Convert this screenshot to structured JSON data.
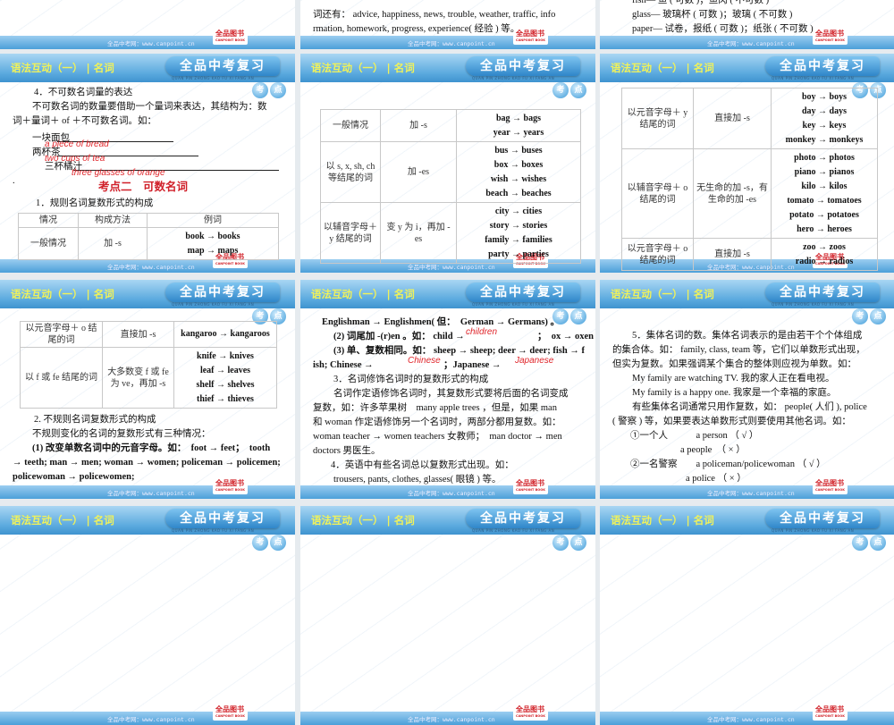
{
  "header": {
    "title_left": "语法互动（一）",
    "sep": "|",
    "title_right": "名词",
    "brand": "全品中考复习",
    "brand_sub": "QUAN PIN ZHONG KAO FU XI FANG AN",
    "badge_1": "考",
    "badge_2": "点"
  },
  "footer": {
    "site": "全品中考网：www.canpoint.cn",
    "logo": "全品图书",
    "logo_sub": "CANPOINT BOOK"
  },
  "slides": {
    "top_middle": {
      "lines": [
        "词还有： advice, happiness, news, trouble, weather, traffic, info",
        "rmation, homework, progress, experience( 经验 ) 等。"
      ]
    },
    "top_right": {
      "lines": [
        "fish— 鱼 ( 可数 )；鱼肉 ( 不可数 )",
        "glass— 玻璃杯 ( 可数 )；玻璃 ( 不可数 )",
        "paper— 试卷，报纸 ( 可数 )；纸张 ( 不可数 )"
      ]
    },
    "s1": {
      "heading": "4．不可数名词量的表达",
      "p1": "不可数名词的数量要借助一个量词来表达，其结构为：数",
      "p2": "词＋量词＋ of ＋不可数名词。如：",
      "q1": "一块面包",
      "a1": "a piece of bread",
      "q2": "两杯茶",
      "a2": "two cups of tea",
      "q3": "三杯橘汁",
      "a3": "three glasses of orange",
      "dot": ".",
      "section": "考点二　可数名词",
      "sub": "1．规则名词复数形式的构成",
      "table": {
        "headers": [
          "情况",
          "构成方法",
          "例词"
        ],
        "rows": [
          {
            "case": "一般情况",
            "method": "加 -s",
            "examples": [
              "book → books",
              "map → maps"
            ]
          }
        ]
      }
    },
    "s2": {
      "table": {
        "rows": [
          {
            "case": "一般情况",
            "method": "加 -s",
            "examples": [
              "bag → bags",
              "year → years"
            ]
          },
          {
            "case": "以 s, x, sh, ch 等结尾的词",
            "method": "加 -es",
            "examples": [
              "bus → buses",
              "box → boxes",
              "wish → wishes",
              "beach → beaches"
            ]
          },
          {
            "case": "以辅音字母＋ y 结尾的词",
            "method": "变 y 为 i，再加 -es",
            "examples": [
              "city → cities",
              "story → stories",
              "family → families",
              "party → parties"
            ]
          }
        ]
      }
    },
    "s3": {
      "table": {
        "rows": [
          {
            "case": "以元音字母＋ y 结尾的词",
            "method": "直接加 -s",
            "examples": [
              "boy → boys",
              "day → days",
              "key → keys",
              "monkey → monkeys"
            ]
          },
          {
            "case": "以辅音字母＋ o 结尾的词",
            "method": "无生命的加 -s，有生命的加 -es",
            "examples": [
              "photo → photos",
              "piano → pianos",
              "kilo → kilos",
              "tomato → tomatoes",
              "potato → potatoes",
              "hero → heroes"
            ]
          },
          {
            "case": "以元音字母＋ o 结尾的词",
            "method": "直接加 -s",
            "examples": [
              "zoo → zoos",
              "radio → radios"
            ]
          }
        ]
      }
    },
    "s4": {
      "table": {
        "rows": [
          {
            "case": "以元音字母＋ o 结尾的词",
            "method": "直接加 -s",
            "examples": [
              "kangaroo → kangaroos"
            ]
          },
          {
            "case": "以 f 或 fe 结尾的词",
            "method": "大多数变 f 或 fe 为 ve，再加 -s",
            "examples": [
              "knife → knives",
              "leaf → leaves",
              "shelf → shelves",
              "thief → thieves"
            ]
          }
        ]
      },
      "lines": [
        "2. 不规则名词复数形式的构成",
        "不规则变化的名词的复数形式有三种情况：",
        "(1) 改变单数名词中的元音字母。如：　foot → feet；　tooth",
        "→ teeth;  man → men;  woman → women;  policeman → policemen;",
        "policewoman → policewomen;"
      ]
    },
    "s5": {
      "l1": "Englishman → Englishmen( 但：　German → Germans) 。",
      "l2a": "(2) 词尾加 -(r)en 。如：  child →",
      "a_children": "children",
      "l2b": "；　ox → oxen",
      "l3": "(3) 单、复数相同。如：  sheep → sheep; deer → deer; fish → f",
      "l4a": "ish; Chinese →",
      "a_chinese": "Chinese",
      "l4b": "；Japanese →",
      "a_japanese": "Japanese",
      "lines": [
        "3．名词修饰名词时的复数形式的构成",
        "名词作定语修饰名词时，其复数形式要将后面的名词变成",
        "复数，如：许多苹果树　many apple trees ，但是，如果 man",
        "和 woman 作定语修饰另一个名词时，两部分都用复数。如：",
        "woman teacher → women teachers 女教师；　man doctor → men",
        "doctors 男医生。",
        "4．英语中有些名词总以复数形式出现。如：",
        "trousers, pants, clothes, glasses( 眼镜 ) 等。"
      ]
    },
    "s6": {
      "lines": [
        "5．集体名词的数。集体名词表示的是由若干个个体组成",
        "的集合体。如： family, class, team 等，它们以单数形式出现，",
        "但实为复数。如果强调某个集合的整体则应视为单数。如：",
        "My family are watching TV. 我的家人正在看电视。",
        "My family is a happy one. 我家是一个幸福的家庭。",
        "有些集体名词通常只用作复数，如： people( 人们 ), police",
        "( 警察 ) 等，如果要表达单数形式则要使用其他名词。如：",
        "①一个人　　　a person （ √ ）",
        "a people　（ × ）",
        "②一名警察　　a policeman/policewoman （ √ ）",
        "a police （ × ）"
      ]
    }
  }
}
